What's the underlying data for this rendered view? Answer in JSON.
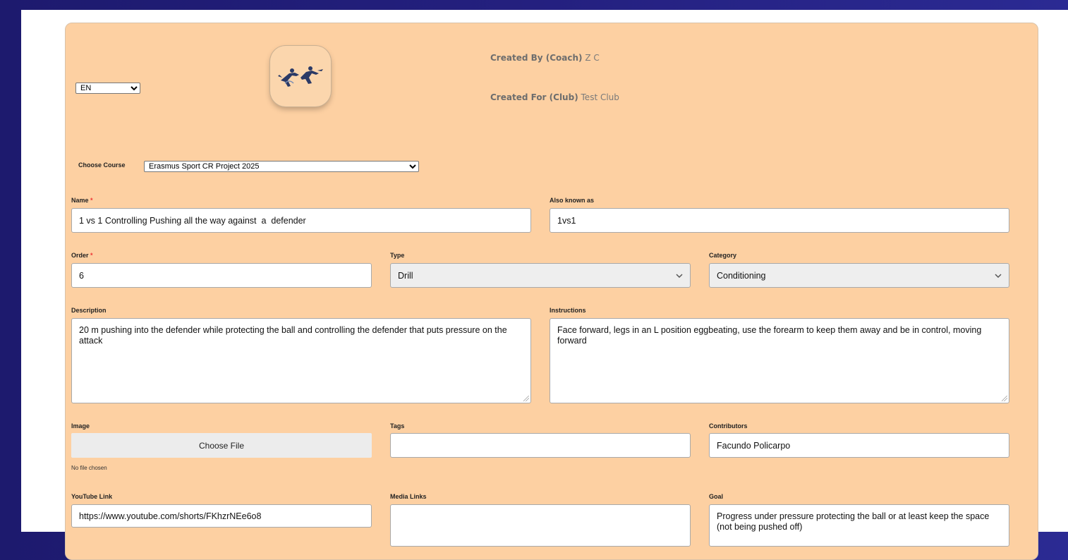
{
  "header": {
    "language": "EN",
    "created_by_label": "Created By (Coach)",
    "created_by_value": "Z C",
    "created_for_label": "Created For (Club)",
    "created_for_value": "Test Club",
    "logo_icon": "water-polo-players-icon"
  },
  "course": {
    "label": "Choose Course",
    "selected": "Erasmus Sport CR Project 2025"
  },
  "form": {
    "name": {
      "label": "Name",
      "required_mark": "*",
      "value": "1 vs 1 Controlling Pushing all the way against  a  defender"
    },
    "aka": {
      "label": "Also known as",
      "value": "1vs1"
    },
    "order": {
      "label": "Order",
      "required_mark": "*",
      "value": "6"
    },
    "type": {
      "label": "Type",
      "selected": "Drill"
    },
    "category": {
      "label": "Category",
      "selected": "Conditioning"
    },
    "description": {
      "label": "Description",
      "value": "20 m pushing into the defender while protecting the ball and controlling the defender that puts pressure on the attack"
    },
    "instructions": {
      "label": "Instructions",
      "value": "Face forward, legs in an L position eggbeating, use the forearm to keep them away and be in control, moving forward"
    },
    "image": {
      "label": "Image",
      "button": "Choose File",
      "status": "No file chosen"
    },
    "tags": {
      "label": "Tags",
      "value": ""
    },
    "contributors": {
      "label": "Contributors",
      "value": "Facundo Policarpo"
    },
    "youtube": {
      "label": "YouTube Link",
      "value": "https://www.youtube.com/shorts/FKhzrNEe6o8"
    },
    "media_links": {
      "label": "Media Links",
      "value": ""
    },
    "goal": {
      "label": "Goal",
      "value": "Progress under pressure protecting the ball or at least keep the space (not being pushed off)"
    }
  }
}
